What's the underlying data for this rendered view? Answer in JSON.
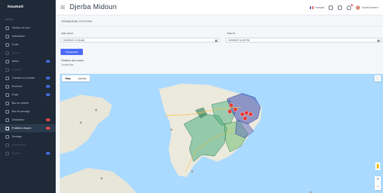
{
  "brand": "houmeti",
  "sidebar": {
    "section_title": "MENU",
    "items": [
      {
        "label": "Tableau de bord",
        "badge": "",
        "state": "normal"
      },
      {
        "label": "Statistiques",
        "badge": "",
        "state": "normal"
      },
      {
        "label": "Droits",
        "badge": "",
        "state": "normal"
      },
      {
        "label": "Actions",
        "badge": "",
        "state": "dim"
      },
      {
        "label": "Météo",
        "badge": "blue",
        "state": "normal"
      },
      {
        "label": "Conseils",
        "badge": "",
        "state": "dim"
      },
      {
        "label": "Chantiers à Domicile",
        "badge": "blue",
        "state": "normal"
      },
      {
        "label": "Élections",
        "badge": "blue",
        "state": "normal"
      },
      {
        "label": "Projet",
        "badge": "blue",
        "state": "normal"
      },
      {
        "label": "Bac de collecte",
        "badge": "",
        "state": "normal"
      },
      {
        "label": "Bac de passage",
        "badge": "",
        "state": "normal"
      },
      {
        "label": "Déclaration",
        "badge": "red",
        "state": "normal"
      },
      {
        "label": "Problème citoyen",
        "badge": "red",
        "state": "active"
      },
      {
        "label": "Sondage",
        "badge": "",
        "state": "normal"
      },
      {
        "label": "Associations",
        "badge": "",
        "state": "dim"
      },
      {
        "label": "Support",
        "badge": "blue",
        "state": "dim"
      }
    ]
  },
  "header": {
    "menu_icon": "hamburger-icon",
    "title": "Djerba Midoun",
    "language": "Français",
    "notification_count": "9",
    "user_name": "Touati Houcem"
  },
  "content": {
    "subtitle": "PROBLÈME CITOYEN",
    "date_start_label": "Date début",
    "date_start_value": "9/20/2022 12:00 AM",
    "date_end_label": "Date fin",
    "date_end_value": "9/20/2022 11:59 PM",
    "search_button": "Recherche",
    "map_title": "Partition des zones",
    "map_subtitle": "Google Map",
    "map_type_plan": "Plan",
    "map_type_satellite": "Satellite"
  },
  "colors": {
    "sidebar_bg": "#1f2a38",
    "accent": "#4a6cf7",
    "water": "#aadaff",
    "zone_green": "#4caf7d",
    "zone_blue": "#3f51b5",
    "marker_red": "#e53935"
  }
}
